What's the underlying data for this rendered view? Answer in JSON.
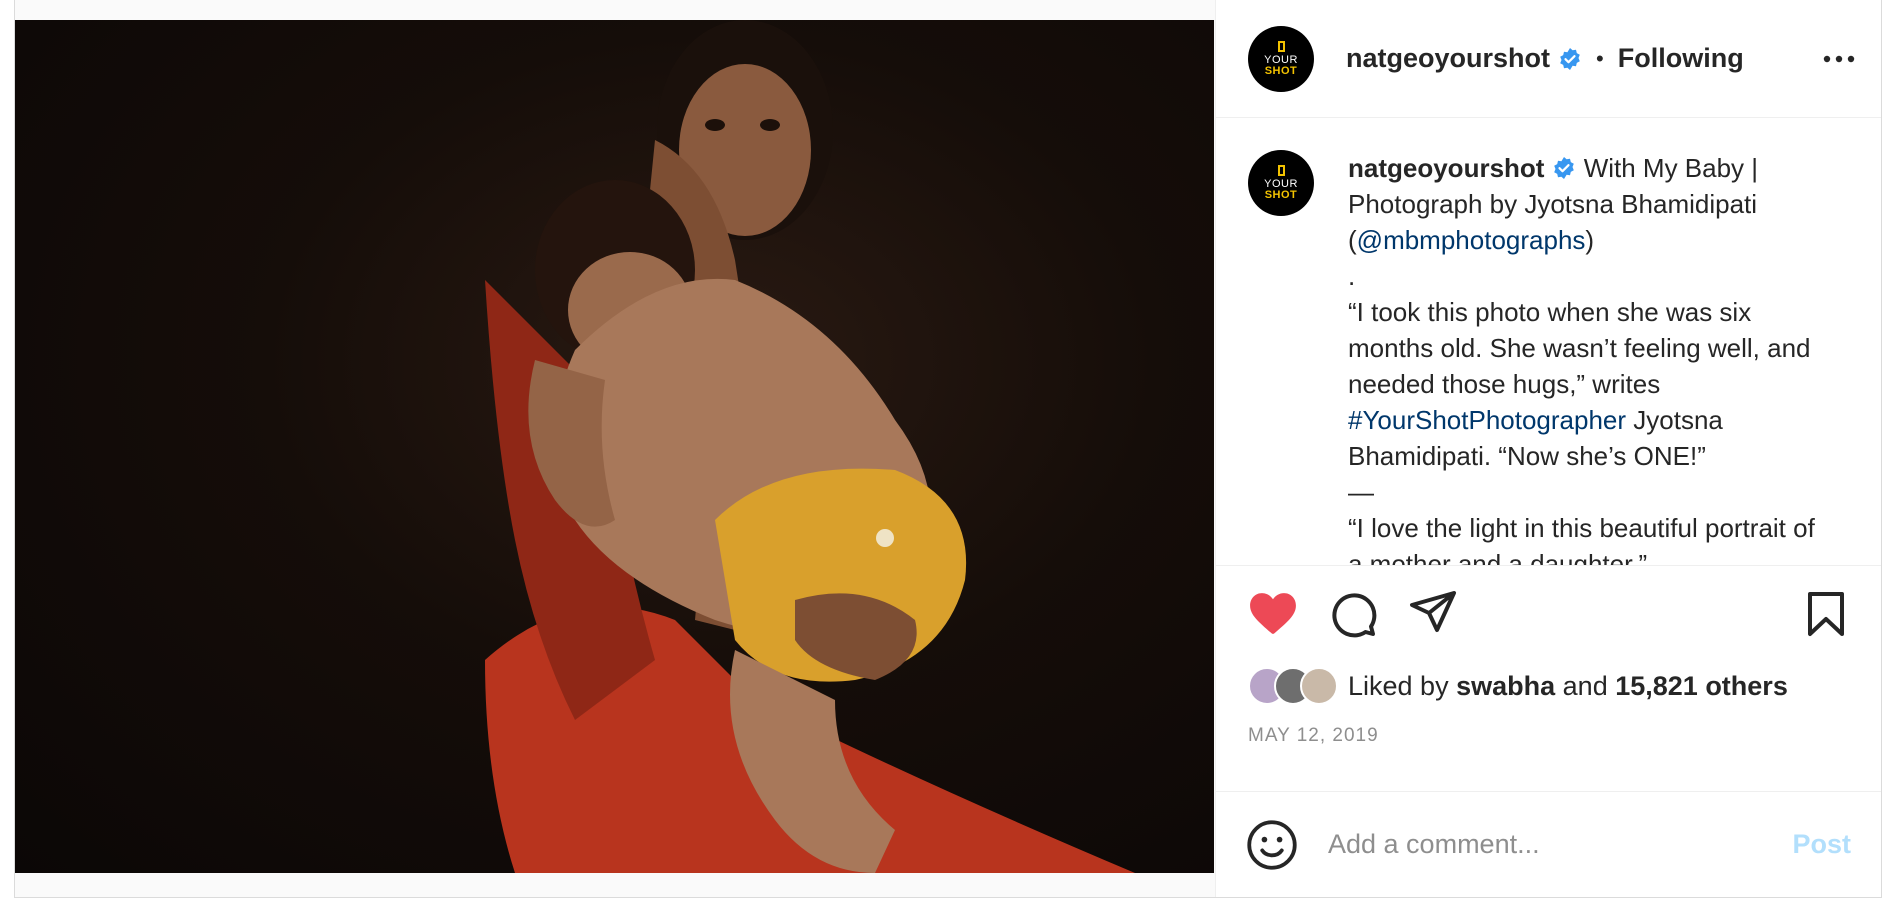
{
  "photo": {
    "alt_icon": "photo-of-mother-holding-baby"
  },
  "header": {
    "avatar_top": "YOUR",
    "avatar_bottom": "SHOT",
    "username": "natgeoyourshot",
    "separator": "•",
    "follow_status": "Following",
    "more_icon": "more-options-icon"
  },
  "caption": {
    "username": "natgeoyourshot",
    "title": "With My Baby | Photograph by Jyotsna Bhamidipati",
    "open_paren": "(",
    "mention": "@mbmphotographs",
    "close_paren": ")",
    "dot_line": ".",
    "quote1_part1": "“I took this photo when she was six months old. She wasn’t feeling well, and needed those hugs,” writes",
    "hashtag": "#YourShotPhotographer",
    "quote1_part2": "Jyotsna Bhamidipati. “Now she’s ONE!”",
    "dash_line": "—",
    "quote2": "“I love the light in this beautiful portrait of a mother and a daughter,”"
  },
  "actions": {
    "like_icon": "heart-icon",
    "comment_icon": "comment-icon",
    "share_icon": "send-icon",
    "save_icon": "bookmark-icon",
    "liked": true
  },
  "likes": {
    "prefix": "Liked by",
    "user": "swabha",
    "connector": "and",
    "others": "15,821 others"
  },
  "date": "MAY 12, 2019",
  "comment": {
    "placeholder": "Add a comment...",
    "post_label": "Post"
  },
  "colors": {
    "accent_like": "#ed4956",
    "link": "#00376b",
    "post_disabled": "#b2dffc",
    "verified": "#3897f0",
    "muted": "#8e8e8e"
  }
}
